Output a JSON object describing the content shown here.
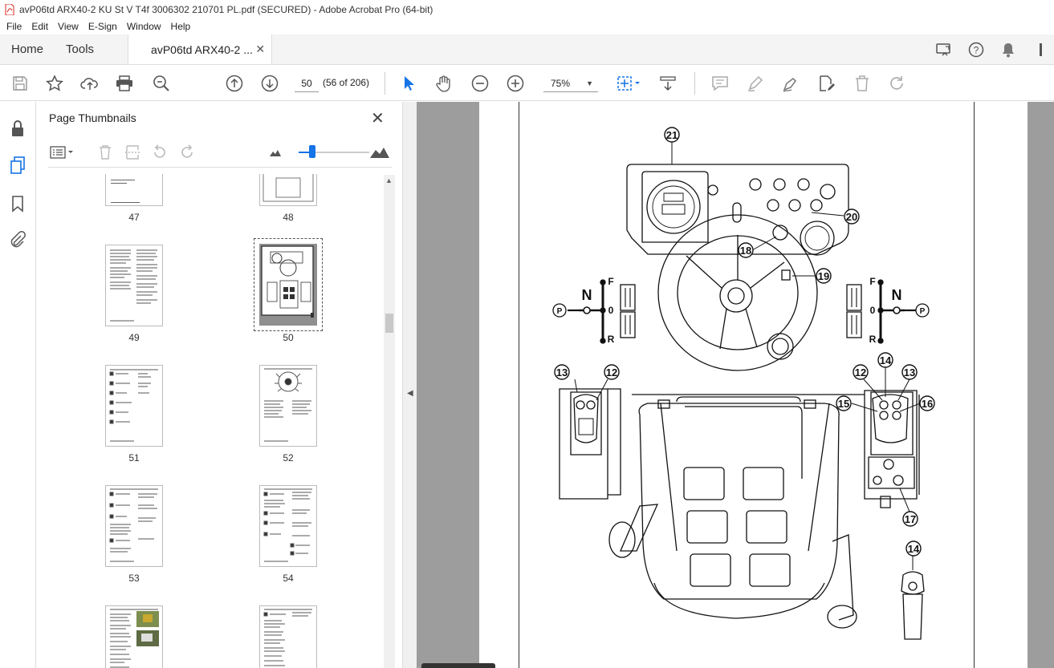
{
  "window": {
    "title": "avP06td ARX40-2 KU St V T4f 3006302 210701 PL.pdf (SECURED) - Adobe Acrobat Pro (64-bit)"
  },
  "menu": [
    "File",
    "Edit",
    "View",
    "E-Sign",
    "Window",
    "Help"
  ],
  "tabs": {
    "home": "Home",
    "tools": "Tools",
    "document": "avP06td ARX40-2 ..."
  },
  "toolbar": {
    "page_number": "50",
    "page_count": "(56 of 206)",
    "zoom": "75%"
  },
  "thumbnails_panel": {
    "title": "Page Thumbnails",
    "pages": [
      {
        "label": "47"
      },
      {
        "label": "48"
      },
      {
        "label": "49"
      },
      {
        "label": "50"
      },
      {
        "label": "51"
      },
      {
        "label": "52"
      },
      {
        "label": "53"
      },
      {
        "label": "54"
      }
    ],
    "selected_page": "50",
    "zoom_slider_fraction": 0.15
  },
  "diagram": {
    "callouts": [
      "21",
      "20",
      "18",
      "19",
      "13",
      "12",
      "14",
      "15",
      "16",
      "17"
    ],
    "shift_labels": {
      "neutral": "N",
      "forward": "F",
      "zero": "0",
      "reverse": "R",
      "park": "P"
    }
  },
  "colors": {
    "accent": "#1473e6",
    "doc_background": "#9d9d9d",
    "pdf_red": "#d8261c"
  }
}
